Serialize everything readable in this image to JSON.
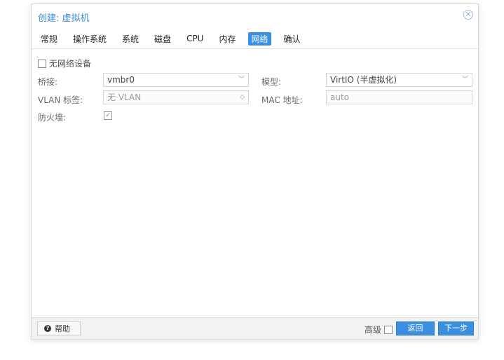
{
  "window": {
    "title": "创建: 虚拟机",
    "close_icon": "×"
  },
  "tabs": [
    {
      "label": "常规"
    },
    {
      "label": "操作系统"
    },
    {
      "label": "系统"
    },
    {
      "label": "磁盘"
    },
    {
      "label": "CPU"
    },
    {
      "label": "内存"
    },
    {
      "label": "网络",
      "active": true
    },
    {
      "label": "确认"
    }
  ],
  "form": {
    "no_network_label": "无网络设备",
    "bridge_label": "桥接:",
    "bridge_value": "vmbr0",
    "vlan_label": "VLAN 标签:",
    "vlan_value": "无 VLAN",
    "firewall_label": "防火墙:",
    "model_label": "模型:",
    "model_value": "VirtIO (半虚拟化)",
    "mac_label": "MAC 地址:",
    "mac_value": "auto"
  },
  "footer": {
    "help_label": "帮助",
    "advanced_label": "高级",
    "back_label": "返回",
    "next_label": "下一步"
  },
  "colors": {
    "accent": "#3b8fe1",
    "title": "#3f8ed8"
  }
}
